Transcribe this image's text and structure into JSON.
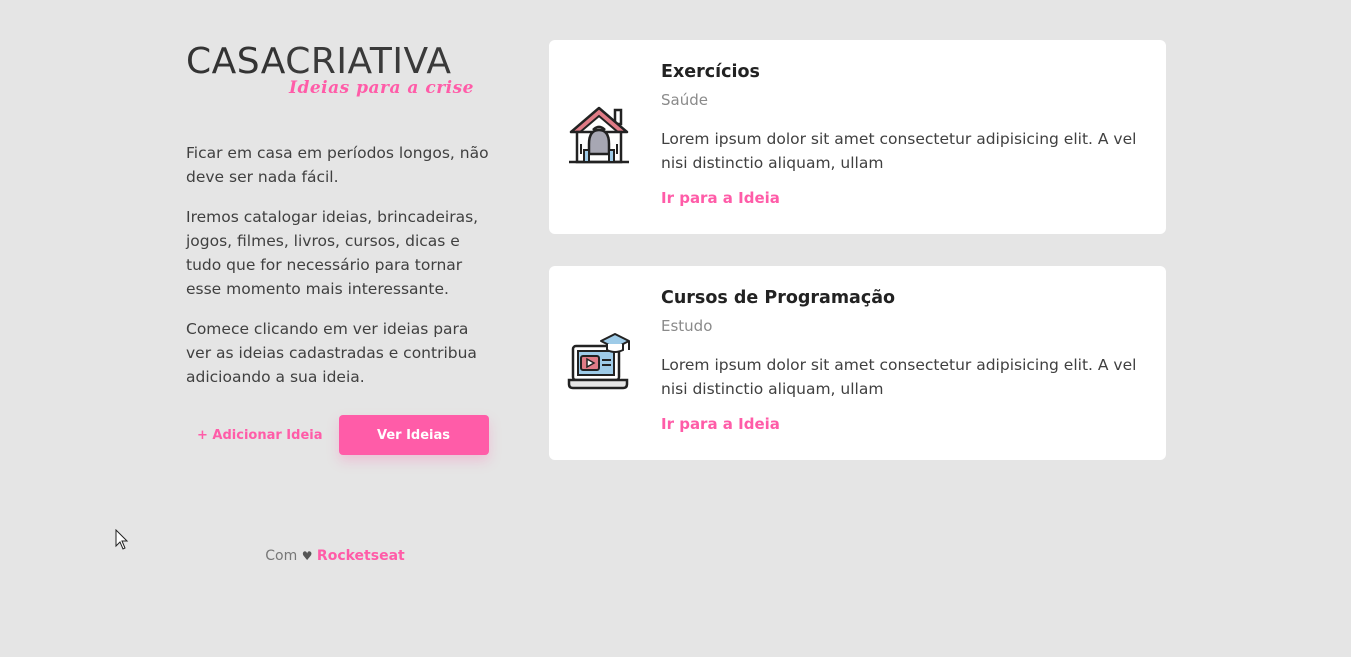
{
  "brand": {
    "name_bold": "CASA",
    "name_light": "CRIATIVA",
    "tagline": "Ideias para a crise",
    "accent_color": "#ff5ca8"
  },
  "intro": {
    "paragraphs": [
      "Ficar em casa em períodos longos, não deve ser nada fácil.",
      "Iremos catalogar ideias, brincadeiras, jogos, filmes, livros, cursos, dicas e tudo que for necessário para tornar esse momento mais interessante.",
      "Comece clicando em ver ideias para ver as ideias cadastradas e contribua adicioando a sua ideia."
    ]
  },
  "actions": {
    "add_label": "+ Adicionar Ideia",
    "view_label": "Ver Ideias"
  },
  "footer": {
    "prefix": "Com",
    "heart": "♥",
    "brand": "Rocketseat"
  },
  "ideas": [
    {
      "icon": "home-gym-icon",
      "title": "Exercícios",
      "category": "Saúde",
      "description": "Lorem ipsum dolor sit amet consectetur adipisicing elit. A vel nisi distinctio aliquam, ullam",
      "link_label": "Ir para a Ideia"
    },
    {
      "icon": "online-course-icon",
      "title": "Cursos de Programação",
      "category": "Estudo",
      "description": "Lorem ipsum dolor sit amet consectetur adipisicing elit. A vel nisi distinctio aliquam, ullam",
      "link_label": "Ir para a Ideia"
    }
  ]
}
